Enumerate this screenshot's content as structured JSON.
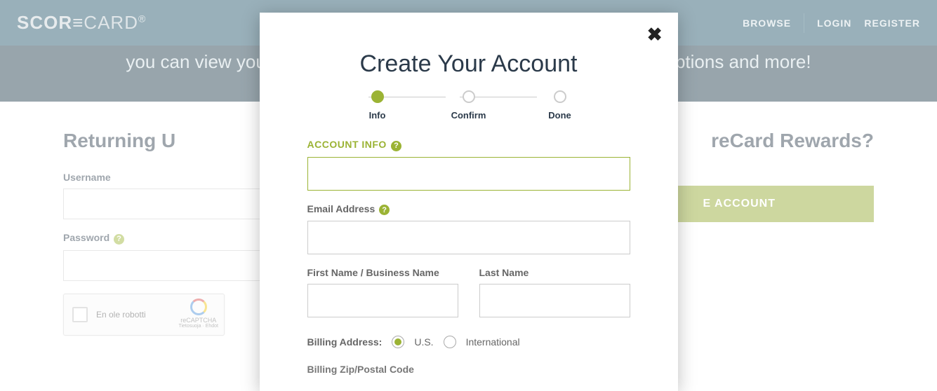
{
  "brand": {
    "score": "SCOR",
    "e_glyph": "≡",
    "card": "CARD",
    "mark": "®"
  },
  "nav": {
    "browse": "BROWSE",
    "login": "LOGIN",
    "register": "REGISTER"
  },
  "tagline": {
    "left": "you can view your",
    "right": "options and more!"
  },
  "page": {
    "returning": {
      "title": "Returning U",
      "username_label": "Username",
      "password_label": "Password",
      "recaptcha_text": "En ole robotti",
      "recaptcha_badge": "reCAPTCHA",
      "recaptcha_terms": "Tietosuoja · Ehdot"
    },
    "newuser": {
      "title_right": "reCard Rewards?",
      "cta": "E ACCOUNT"
    }
  },
  "modal": {
    "title": "Create Your Account",
    "close_glyph": "✖",
    "steps": {
      "info": "Info",
      "confirm": "Confirm",
      "done": "Done"
    },
    "section_label": "ACCOUNT INFO",
    "help_glyph": "?",
    "email_label": "Email Address",
    "first_label": "First Name / Business Name",
    "last_label": "Last Name",
    "billing_label": "Billing Address:",
    "billing_us": "U.S.",
    "billing_intl": "International",
    "zip_cut": "Billing Zip/Postal Code"
  }
}
